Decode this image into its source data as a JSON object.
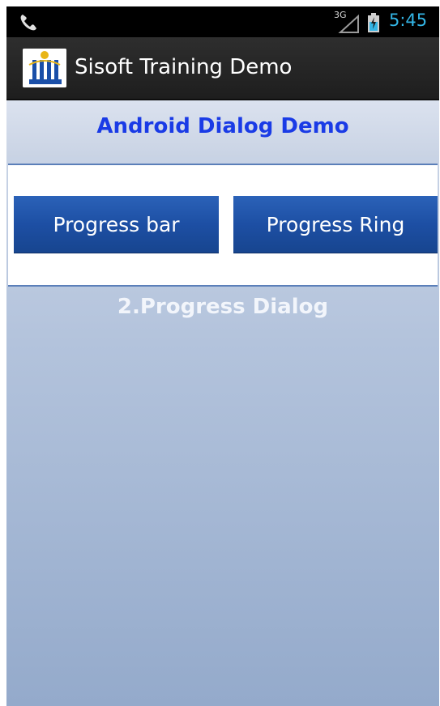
{
  "status_bar": {
    "time": "5:45",
    "signal_label": "3G",
    "icons": [
      "phone-icon",
      "signal-icon",
      "battery-icon"
    ]
  },
  "action_bar": {
    "title": "Sisoft Training Demo",
    "icon": "app-logo-icon"
  },
  "page": {
    "title": "Android Dialog Demo",
    "subtitle": "2.Progress Dialog"
  },
  "buttons": {
    "progress_bar": "Progress bar",
    "progress_ring": "Progress Ring"
  },
  "colors": {
    "title_blue": "#1a3be6",
    "button_blue": "#1d4fa4",
    "clock_blue": "#33b5e5"
  }
}
